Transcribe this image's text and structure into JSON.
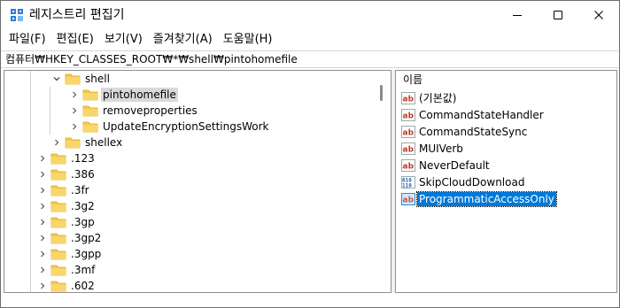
{
  "window": {
    "title": "레지스트리 편집기"
  },
  "menu": [
    {
      "label": "파일(F)"
    },
    {
      "label": "편집(E)"
    },
    {
      "label": "보기(V)"
    },
    {
      "label": "즐겨찾기(A)"
    },
    {
      "label": "도움말(H)"
    }
  ],
  "address": {
    "path": "컴퓨터₩HKEY_CLASSES_ROOT₩*₩shell₩pintohomefile"
  },
  "tree": {
    "items": [
      {
        "label": "shell",
        "expanded": true,
        "level": 2,
        "selected": false
      },
      {
        "label": "pintohomefile",
        "expanded": false,
        "level": 3,
        "selected": true
      },
      {
        "label": "removeproperties",
        "expanded": false,
        "level": 3,
        "selected": false
      },
      {
        "label": "UpdateEncryptionSettingsWork",
        "expanded": false,
        "level": 3,
        "selected": false
      },
      {
        "label": "shellex",
        "expanded": false,
        "level": 2,
        "selected": false
      },
      {
        "label": ".123",
        "expanded": false,
        "level": 1,
        "selected": false
      },
      {
        "label": ".386",
        "expanded": false,
        "level": 1,
        "selected": false
      },
      {
        "label": ".3fr",
        "expanded": false,
        "level": 1,
        "selected": false
      },
      {
        "label": ".3g2",
        "expanded": false,
        "level": 1,
        "selected": false
      },
      {
        "label": ".3gp",
        "expanded": false,
        "level": 1,
        "selected": false
      },
      {
        "label": ".3gp2",
        "expanded": false,
        "level": 1,
        "selected": false
      },
      {
        "label": ".3gpp",
        "expanded": false,
        "level": 1,
        "selected": false
      },
      {
        "label": ".3mf",
        "expanded": false,
        "level": 1,
        "selected": false
      },
      {
        "label": ".602",
        "expanded": false,
        "level": 1,
        "selected": false
      }
    ]
  },
  "values": {
    "column_name": "이름",
    "items": [
      {
        "name": "(기본값)",
        "icon": "string-value-icon",
        "selected": false
      },
      {
        "name": "CommandStateHandler",
        "icon": "string-value-icon",
        "selected": false
      },
      {
        "name": "CommandStateSync",
        "icon": "string-value-icon",
        "selected": false
      },
      {
        "name": "MUIVerb",
        "icon": "string-value-icon",
        "selected": false
      },
      {
        "name": "NeverDefault",
        "icon": "string-value-icon",
        "selected": false
      },
      {
        "name": "SkipCloudDownload",
        "icon": "binary-value-icon",
        "selected": false
      },
      {
        "name": "ProgrammaticAccessOnly",
        "icon": "string-value-icon",
        "selected": true
      }
    ]
  },
  "colors": {
    "folder": "#f4c84b",
    "selection": "#0078d7",
    "tree_selection": "#d9d9d9",
    "string_icon": "#c0392b",
    "binary_icon": "#1f5fa8"
  }
}
